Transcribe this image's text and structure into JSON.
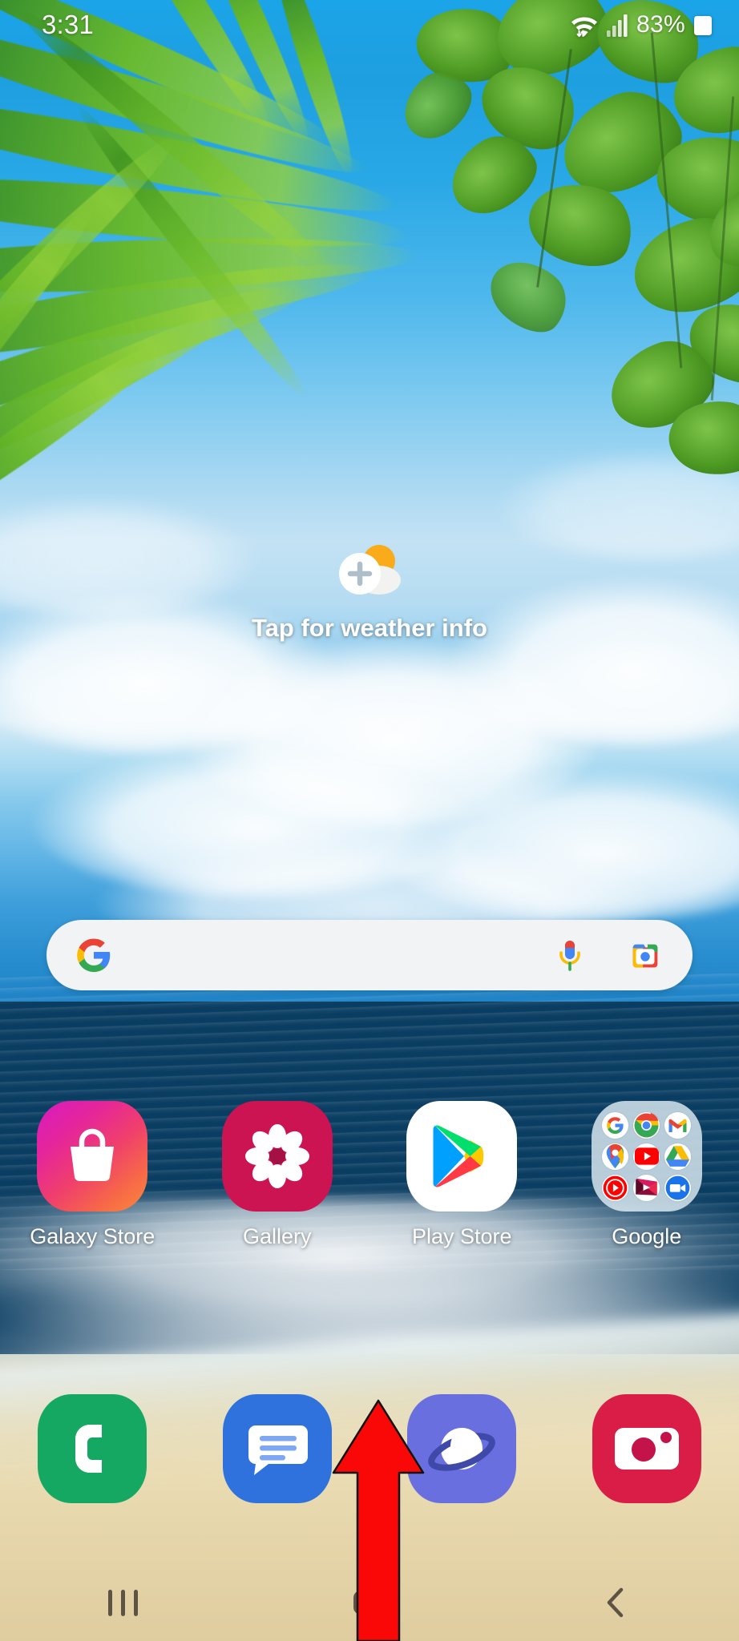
{
  "status_bar": {
    "time": "3:31",
    "battery_percent": "83%",
    "icons": [
      "wifi-icon",
      "signal-icon",
      "battery-icon"
    ]
  },
  "weather_widget": {
    "label": "Tap for weather info",
    "icon": "partly-cloudy-plus-icon"
  },
  "search": {
    "placeholder": "",
    "value": "",
    "logo": "google-g-icon",
    "mic": "microphone-icon",
    "lens": "google-lens-icon"
  },
  "apps": [
    {
      "label": "Galaxy Store",
      "icon": "galaxy-store-icon"
    },
    {
      "label": "Gallery",
      "icon": "gallery-icon"
    },
    {
      "label": "Play Store",
      "icon": "play-store-icon"
    },
    {
      "label": "Google",
      "icon": "google-folder-icon"
    }
  ],
  "google_folder": {
    "items": [
      "google-icon",
      "chrome-icon",
      "gmail-icon",
      "maps-icon",
      "youtube-icon",
      "drive-icon",
      "youtube-music-icon",
      "play-movies-icon",
      "meet-icon"
    ]
  },
  "dock": [
    {
      "label": "Phone",
      "icon": "phone-icon"
    },
    {
      "label": "Messages",
      "icon": "messages-icon"
    },
    {
      "label": "Internet",
      "icon": "samsung-internet-icon"
    },
    {
      "label": "Camera",
      "icon": "camera-icon"
    }
  ],
  "nav_bar": {
    "recents": "recent-apps-icon",
    "home": "home-icon",
    "back": "back-icon"
  },
  "annotation": {
    "type": "red-arrow-up",
    "color": "#fa0808"
  },
  "colors": {
    "galaxy_store": "#e5259b",
    "gallery": "#cd1452",
    "phone": "#15a862",
    "messages": "#2f72dd",
    "internet": "#6a6fe0",
    "camera": "#d91d46",
    "arrow": "#fa0808"
  }
}
